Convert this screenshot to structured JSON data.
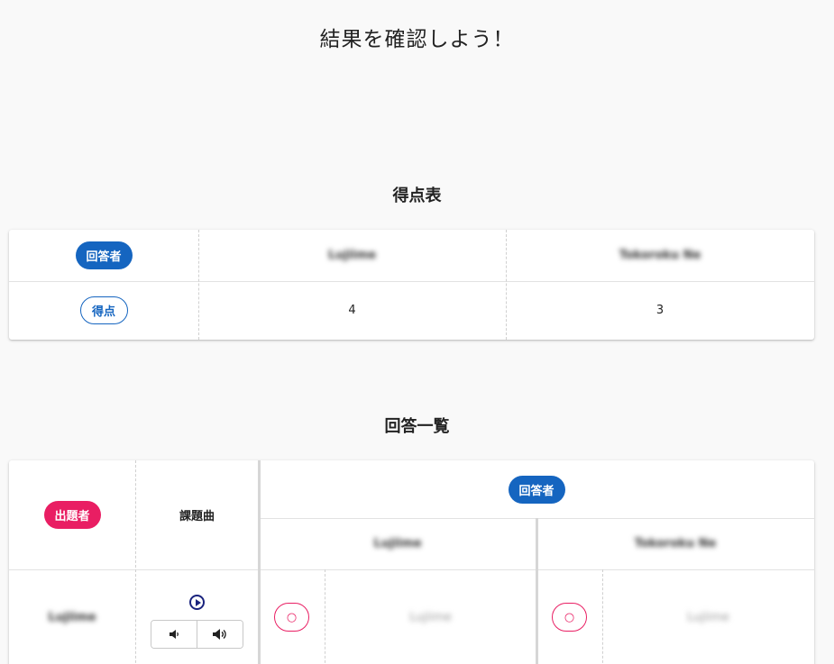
{
  "page_title": "結果を確認しよう！",
  "score_table": {
    "title": "得点表",
    "header_badge": "回答者",
    "row_badge": "得点",
    "players": [
      {
        "name": "Lujiime",
        "score": "4"
      },
      {
        "name": "Tokoroku Ne",
        "score": "3"
      }
    ]
  },
  "answers_table": {
    "title": "回答一覧",
    "setter_badge": "出題者",
    "song_header": "課題曲",
    "answerers_badge": "回答者",
    "answerers": [
      "Lujiime",
      "Tokoroku Ne"
    ],
    "rows": [
      {
        "setter": "Lujiime",
        "answers": [
          {
            "mark": "○",
            "answer": "Lujiime"
          },
          {
            "mark": "○",
            "answer": "Lujiime"
          }
        ]
      }
    ]
  },
  "icons": {
    "play": "play-circle-icon",
    "volume_down": "volume-down-icon",
    "volume_up": "volume-up-icon"
  },
  "colors": {
    "primary_blue": "#1565c0",
    "accent_pink": "#e91e63",
    "navy": "#1a237e"
  }
}
